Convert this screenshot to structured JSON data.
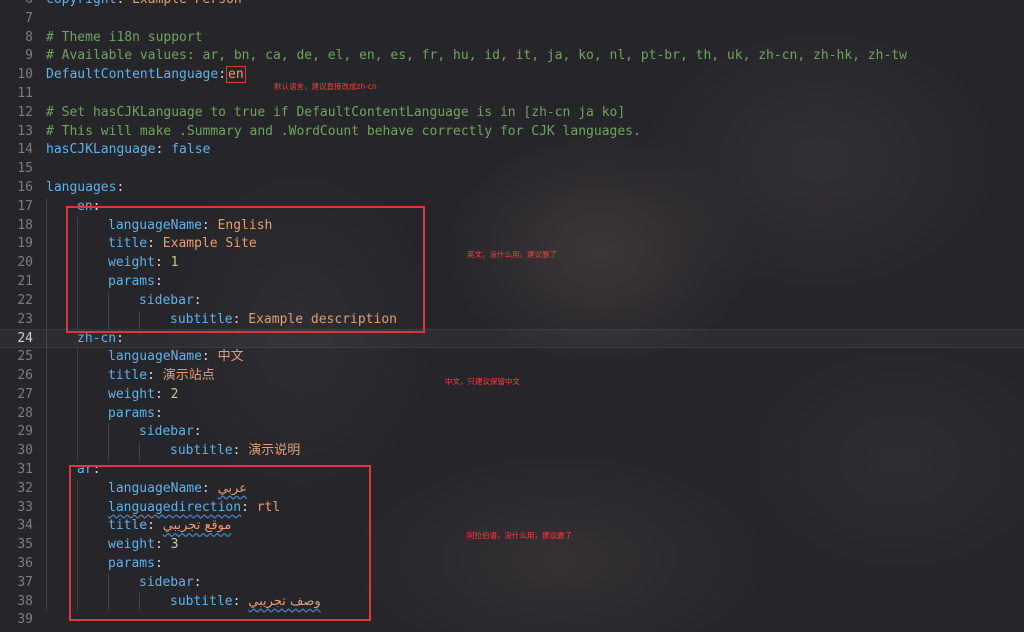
{
  "lines": [
    {
      "n": "6",
      "indent": 0,
      "segs": [
        {
          "t": "copyright",
          "c": "key"
        },
        {
          "t": ": ",
          "c": "punct"
        },
        {
          "t": "Example Person",
          "c": "str"
        }
      ]
    },
    {
      "n": "7",
      "indent": 0,
      "segs": []
    },
    {
      "n": "8",
      "indent": 0,
      "segs": [
        {
          "t": "# Theme i18n support",
          "c": "comment"
        }
      ]
    },
    {
      "n": "9",
      "indent": 0,
      "segs": [
        {
          "t": "# Available values: ar, bn, ca, de, el, en, es, fr, hu, id, it, ja, ko, nl, pt-br, th, uk, zh-cn, zh-hk, zh-tw",
          "c": "comment"
        }
      ]
    },
    {
      "n": "10",
      "indent": 0,
      "segs": [
        {
          "t": "DefaultContentLanguage",
          "c": "key"
        },
        {
          "t": ":",
          "c": "punct"
        },
        {
          "t": "en",
          "c": "str en-box"
        }
      ]
    },
    {
      "n": "11",
      "indent": 0,
      "segs": []
    },
    {
      "n": "12",
      "indent": 0,
      "segs": [
        {
          "t": "# Set hasCJKLanguage to true if DefaultContentLanguage is in [zh-cn ja ko]",
          "c": "comment"
        }
      ]
    },
    {
      "n": "13",
      "indent": 0,
      "segs": [
        {
          "t": "# This will make .Summary and .WordCount behave correctly for CJK languages.",
          "c": "comment"
        }
      ]
    },
    {
      "n": "14",
      "indent": 0,
      "segs": [
        {
          "t": "hasCJKLanguage",
          "c": "key"
        },
        {
          "t": ": ",
          "c": "punct"
        },
        {
          "t": "false",
          "c": "bool"
        }
      ]
    },
    {
      "n": "15",
      "indent": 0,
      "segs": []
    },
    {
      "n": "16",
      "indent": 0,
      "segs": [
        {
          "t": "languages",
          "c": "key"
        },
        {
          "t": ":",
          "c": "punct"
        }
      ]
    },
    {
      "n": "17",
      "indent": 1,
      "segs": [
        {
          "t": "en",
          "c": "key"
        },
        {
          "t": ":",
          "c": "punct"
        }
      ]
    },
    {
      "n": "18",
      "indent": 2,
      "segs": [
        {
          "t": "languageName",
          "c": "key"
        },
        {
          "t": ": ",
          "c": "punct"
        },
        {
          "t": "English",
          "c": "str"
        }
      ]
    },
    {
      "n": "19",
      "indent": 2,
      "segs": [
        {
          "t": "title",
          "c": "key"
        },
        {
          "t": ": ",
          "c": "punct"
        },
        {
          "t": "Example Site",
          "c": "str"
        }
      ]
    },
    {
      "n": "20",
      "indent": 2,
      "segs": [
        {
          "t": "weight",
          "c": "key"
        },
        {
          "t": ": ",
          "c": "punct"
        },
        {
          "t": "1",
          "c": "num"
        }
      ]
    },
    {
      "n": "21",
      "indent": 2,
      "segs": [
        {
          "t": "params",
          "c": "key"
        },
        {
          "t": ":",
          "c": "punct"
        }
      ]
    },
    {
      "n": "22",
      "indent": 3,
      "segs": [
        {
          "t": "sidebar",
          "c": "key"
        },
        {
          "t": ":",
          "c": "punct"
        }
      ]
    },
    {
      "n": "23",
      "indent": 4,
      "segs": [
        {
          "t": "subtitle",
          "c": "key"
        },
        {
          "t": ": ",
          "c": "punct"
        },
        {
          "t": "Example description",
          "c": "str"
        }
      ]
    },
    {
      "n": "24",
      "indent": 1,
      "current": true,
      "segs": [
        {
          "t": "zh-cn",
          "c": "key"
        },
        {
          "t": ":",
          "c": "punct"
        }
      ]
    },
    {
      "n": "25",
      "indent": 2,
      "segs": [
        {
          "t": "languageName",
          "c": "key"
        },
        {
          "t": ": ",
          "c": "punct"
        },
        {
          "t": "中文",
          "c": "cjk-val"
        }
      ]
    },
    {
      "n": "26",
      "indent": 2,
      "segs": [
        {
          "t": "title",
          "c": "key"
        },
        {
          "t": ": ",
          "c": "punct"
        },
        {
          "t": "演示站点",
          "c": "cjk-val"
        }
      ]
    },
    {
      "n": "27",
      "indent": 2,
      "segs": [
        {
          "t": "weight",
          "c": "key"
        },
        {
          "t": ": ",
          "c": "punct"
        },
        {
          "t": "2",
          "c": "num"
        }
      ]
    },
    {
      "n": "28",
      "indent": 2,
      "segs": [
        {
          "t": "params",
          "c": "key"
        },
        {
          "t": ":",
          "c": "punct"
        }
      ]
    },
    {
      "n": "29",
      "indent": 3,
      "segs": [
        {
          "t": "sidebar",
          "c": "key"
        },
        {
          "t": ":",
          "c": "punct"
        }
      ]
    },
    {
      "n": "30",
      "indent": 4,
      "segs": [
        {
          "t": "subtitle",
          "c": "key"
        },
        {
          "t": ": ",
          "c": "punct"
        },
        {
          "t": "演示说明",
          "c": "cjk-val"
        }
      ]
    },
    {
      "n": "31",
      "indent": 1,
      "segs": [
        {
          "t": "ar",
          "c": "key"
        },
        {
          "t": ":",
          "c": "punct"
        }
      ]
    },
    {
      "n": "32",
      "indent": 2,
      "segs": [
        {
          "t": "languageName",
          "c": "key"
        },
        {
          "t": ": ",
          "c": "punct"
        },
        {
          "t": "عربي",
          "c": "ar"
        }
      ]
    },
    {
      "n": "33",
      "indent": 2,
      "segs": [
        {
          "t": "languagedirection",
          "c": "key squig"
        },
        {
          "t": ": ",
          "c": "punct"
        },
        {
          "t": "rtl",
          "c": "str"
        }
      ]
    },
    {
      "n": "34",
      "indent": 2,
      "segs": [
        {
          "t": "title",
          "c": "key"
        },
        {
          "t": ": ",
          "c": "punct"
        },
        {
          "t": "موقع تجريبي",
          "c": "ar"
        }
      ]
    },
    {
      "n": "35",
      "indent": 2,
      "segs": [
        {
          "t": "weight",
          "c": "key"
        },
        {
          "t": ": ",
          "c": "punct"
        },
        {
          "t": "3",
          "c": "num"
        }
      ]
    },
    {
      "n": "36",
      "indent": 2,
      "segs": [
        {
          "t": "params",
          "c": "key"
        },
        {
          "t": ":",
          "c": "punct"
        }
      ]
    },
    {
      "n": "37",
      "indent": 3,
      "segs": [
        {
          "t": "sidebar",
          "c": "key"
        },
        {
          "t": ":",
          "c": "punct"
        }
      ]
    },
    {
      "n": "38",
      "indent": 4,
      "segs": [
        {
          "t": "subtitle",
          "c": "key"
        },
        {
          "t": ": ",
          "c": "punct"
        },
        {
          "t": "وصف تجريبي",
          "c": "ar"
        }
      ]
    },
    {
      "n": "39",
      "indent": 0,
      "segs": []
    }
  ],
  "annotations": {
    "default_lang_note": "默认语言，建议直接改成zh-cn",
    "en_note": "英文，没什么用，建议删了",
    "zh_note": "中文，只建议保留中文",
    "ar_note": "阿拉伯语，没什么用，建议删了"
  },
  "colors": {
    "background": "#26262a",
    "key": "#5fb1ea",
    "string": "#e39c73",
    "number": "#b9d08e",
    "comment": "#6fa35d",
    "annotation": "#ff3b3b"
  }
}
